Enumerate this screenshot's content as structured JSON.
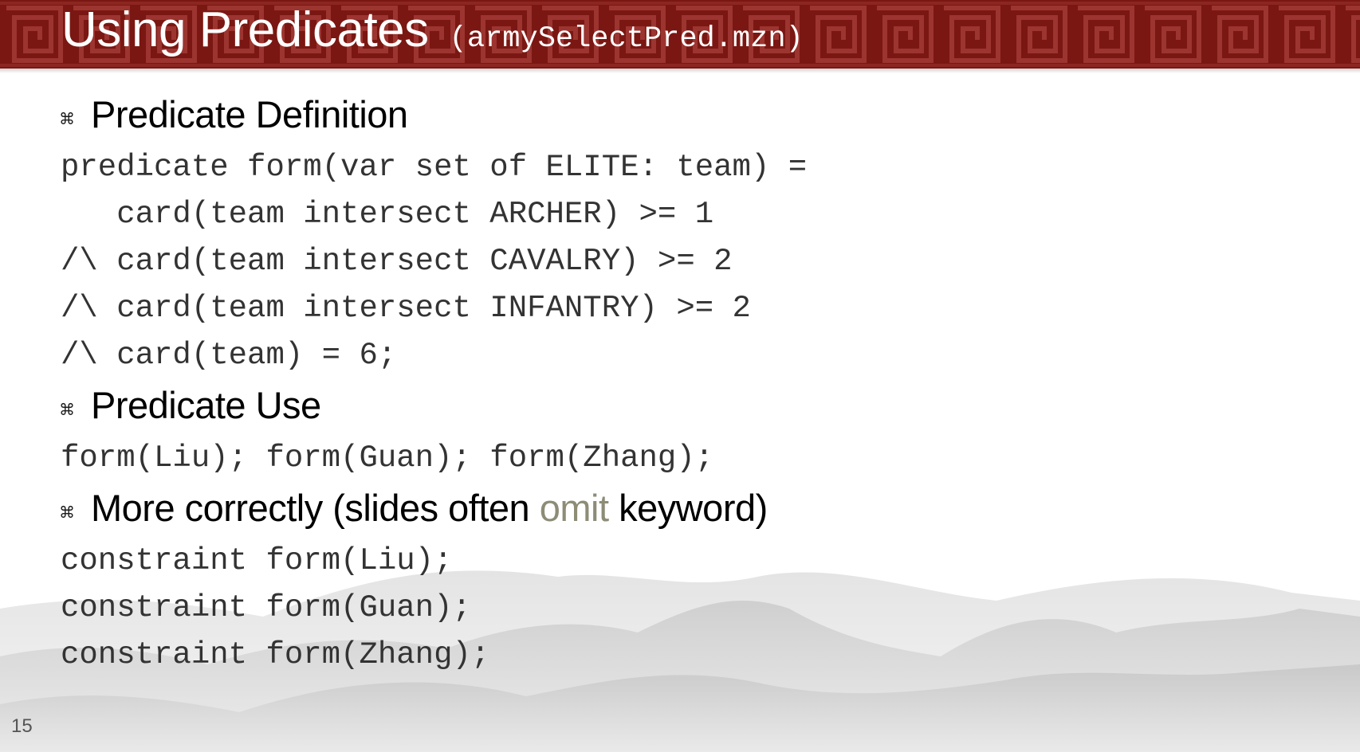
{
  "slide": {
    "title": "Using Predicates",
    "title_file": "(armySelectPred.mzn)",
    "page_number": "15",
    "colors": {
      "banner": "#7a1712",
      "banner_pattern": "#9c3430",
      "accent_word": "#8d8c76",
      "code_text": "#333333"
    },
    "bullet_icon": "command-key-icon",
    "bullets": [
      {
        "text": "Predicate Definition"
      },
      {
        "text": "Predicate Use"
      },
      {
        "text_before": "More correctly (slides often ",
        "accent": "omit",
        "text_after": " keyword)"
      }
    ],
    "code_definition": [
      "predicate form(var set of ELITE: team) =",
      "   card(team intersect ARCHER) >= 1",
      "/\\ card(team intersect CAVALRY) >= 2",
      "/\\ card(team intersect INFANTRY) >= 2",
      "/\\ card(team) = 6;"
    ],
    "code_use": [
      "form(Liu); form(Guan); form(Zhang);"
    ],
    "code_constraints": [
      "constraint form(Liu);",
      "constraint form(Guan);",
      "constraint form(Zhang);"
    ]
  }
}
